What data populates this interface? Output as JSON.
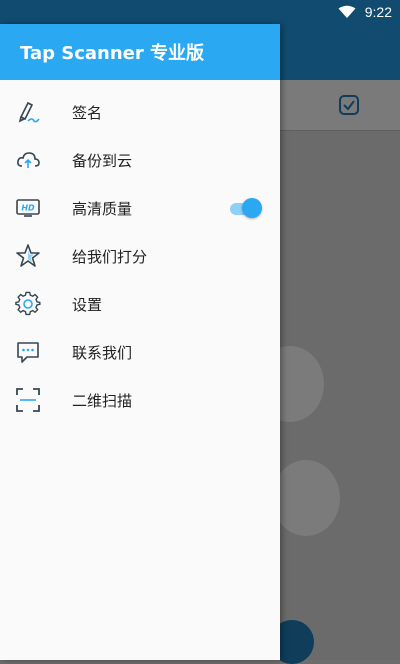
{
  "status_bar": {
    "time": "9:22"
  },
  "drawer": {
    "title": "Tap Scanner 专业版",
    "items": [
      {
        "label": "签名",
        "icon": "signature-icon"
      },
      {
        "label": "备份到云",
        "icon": "cloud-upload-icon"
      },
      {
        "label": "高清质量",
        "icon": "hd-icon",
        "toggle_on": true
      },
      {
        "label": "给我们打分",
        "icon": "star-icon"
      },
      {
        "label": "设置",
        "icon": "gear-icon"
      },
      {
        "label": "联系我们",
        "icon": "chat-icon"
      },
      {
        "label": "二维扫描",
        "icon": "scan-frame-icon"
      }
    ]
  },
  "colors": {
    "header": "#2aa8f2",
    "icon_stroke": "#37474f",
    "icon_accent": "#2aa8f2",
    "app_bar": "#114c70"
  }
}
